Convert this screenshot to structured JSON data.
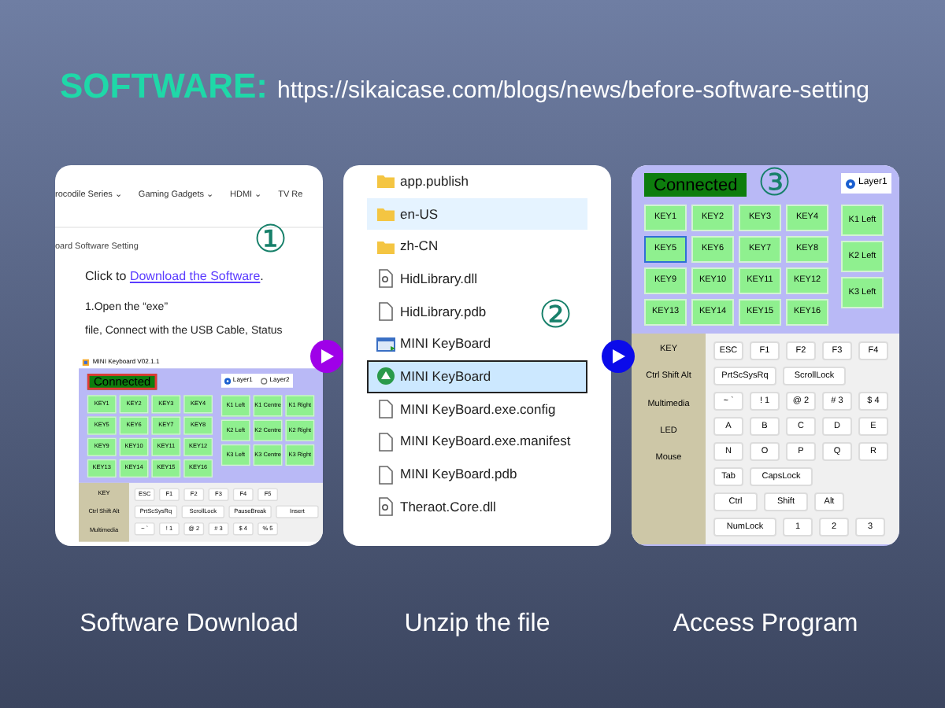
{
  "header": {
    "title": "SOFTWARE:",
    "url": "https://sikaicase.com/blogs/news/before-software-setting"
  },
  "arrows": [
    {
      "color": "#9f00e8"
    },
    {
      "color": "#0b0bea"
    }
  ],
  "steps": [
    {
      "kind": "web",
      "badge": "①",
      "caption": "Software Download",
      "nav": [
        "rocodile Series ⌄",
        "Gaming Gadgets ⌄",
        "HDMI ⌄",
        "TV Re"
      ],
      "breadcrumb": "oard Software Setting",
      "intro": "Click to ",
      "link": "Download the Software",
      "intro_end": ".",
      "lines": [
        "1.Open the “exe”",
        "file, Connect with the USB Cable, Status"
      ],
      "app": {
        "title": "MINI Keyboard V02.1.1",
        "status": "Connected",
        "status_outlined": true,
        "layers": [
          {
            "label": "Layer1",
            "selected": true
          },
          {
            "label": "Layer2",
            "selected": false
          }
        ],
        "keys": [
          {
            "label": "KEY1",
            "selected": false
          },
          {
            "label": "KEY2",
            "selected": false
          },
          {
            "label": "KEY3",
            "selected": false
          },
          {
            "label": "KEY4",
            "selected": false
          },
          {
            "label": "KEY5",
            "selected": false
          },
          {
            "label": "KEY6",
            "selected": false
          },
          {
            "label": "KEY7",
            "selected": false
          },
          {
            "label": "KEY8",
            "selected": false
          },
          {
            "label": "KEY9",
            "selected": false
          },
          {
            "label": "KEY10",
            "selected": false
          },
          {
            "label": "KEY11",
            "selected": false
          },
          {
            "label": "KEY12",
            "selected": false
          },
          {
            "label": "KEY13",
            "selected": false
          },
          {
            "label": "KEY14",
            "selected": false
          },
          {
            "label": "KEY15",
            "selected": false
          },
          {
            "label": "KEY16",
            "selected": false
          }
        ],
        "knob_columns": [
          [
            "K1 Left",
            "K2 Left",
            "K3 Left"
          ],
          [
            "K1 Centre",
            "K2 Centre",
            "K3 Centre"
          ],
          [
            "K1 Right",
            "K2 Right",
            "K3 Right"
          ]
        ],
        "menu": [
          "KEY",
          "Ctrl Shift Alt",
          "Multimedia"
        ],
        "key_rows": [
          [
            "ESC",
            "F1",
            "F2",
            "F3",
            "F4",
            "F5"
          ],
          [
            "PrtScSysRq",
            "ScrollLock",
            "PauseBreak",
            "Insert"
          ],
          [
            "~ `",
            "! 1",
            "@ 2",
            "# 3",
            "$ 4",
            "% 5"
          ]
        ]
      }
    },
    {
      "kind": "files",
      "badge": "②",
      "caption": "Unzip the file",
      "files": [
        {
          "name": "app.publish",
          "kind": "folder",
          "selected": false,
          "highlighted": false
        },
        {
          "name": "en-US",
          "kind": "folder",
          "selected": false,
          "highlighted": true
        },
        {
          "name": "zh-CN",
          "kind": "folder",
          "selected": false,
          "highlighted": false
        },
        {
          "name": "HidLibrary.dll",
          "kind": "library",
          "selected": false,
          "highlighted": false
        },
        {
          "name": "HidLibrary.pdb",
          "kind": "document",
          "selected": false,
          "highlighted": false
        },
        {
          "name": "MINI KeyBoard",
          "kind": "window",
          "selected": false,
          "highlighted": false
        },
        {
          "name": "MINI KeyBoard",
          "kind": "program",
          "selected": true,
          "highlighted": false
        },
        {
          "name": "MINI KeyBoard.exe.config",
          "kind": "document",
          "selected": false,
          "highlighted": false
        },
        {
          "name": "MINI KeyBoard.exe.manifest",
          "kind": "document",
          "selected": false,
          "highlighted": false
        },
        {
          "name": "MINI KeyBoard.pdb",
          "kind": "document",
          "selected": false,
          "highlighted": false
        },
        {
          "name": "Theraot.Core.dll",
          "kind": "library",
          "selected": false,
          "highlighted": false
        }
      ]
    },
    {
      "kind": "app",
      "badge": "③",
      "caption": "Access Program",
      "app": {
        "status": "Connected",
        "status_outlined": false,
        "layers": [
          {
            "label": "Layer1",
            "selected": true
          }
        ],
        "keys": [
          {
            "label": "KEY1",
            "selected": false
          },
          {
            "label": "KEY2",
            "selected": false
          },
          {
            "label": "KEY3",
            "selected": false
          },
          {
            "label": "KEY4",
            "selected": false
          },
          {
            "label": "KEY5",
            "selected": true
          },
          {
            "label": "KEY6",
            "selected": false
          },
          {
            "label": "KEY7",
            "selected": false
          },
          {
            "label": "KEY8",
            "selected": false
          },
          {
            "label": "KEY9",
            "selected": false
          },
          {
            "label": "KEY10",
            "selected": false
          },
          {
            "label": "KEY11",
            "selected": false
          },
          {
            "label": "KEY12",
            "selected": false
          },
          {
            "label": "KEY13",
            "selected": false
          },
          {
            "label": "KEY14",
            "selected": false
          },
          {
            "label": "KEY15",
            "selected": false
          },
          {
            "label": "KEY16",
            "selected": false
          }
        ],
        "knob_columns": [
          [
            "K1 Left",
            "K2 Left",
            "K3 Left"
          ]
        ],
        "menu": [
          "KEY",
          "Ctrl Shift Alt",
          "Multimedia",
          "LED",
          "Mouse"
        ],
        "key_rows": [
          [
            "ESC",
            "F1",
            "F2",
            "F3",
            "F4"
          ],
          [
            "PrtScSysRq",
            "ScrollLock"
          ],
          [
            "~ `",
            "! 1",
            "@ 2",
            "# 3",
            "$ 4"
          ],
          [
            "A",
            "B",
            "C",
            "D",
            "E"
          ],
          [
            "N",
            "O",
            "P",
            "Q",
            "R"
          ],
          [
            "Tab",
            "CapsLock"
          ],
          [
            "Ctrl",
            "Shift",
            "Alt"
          ],
          [
            "NumLock",
            "1",
            "2",
            "3"
          ]
        ]
      }
    }
  ]
}
